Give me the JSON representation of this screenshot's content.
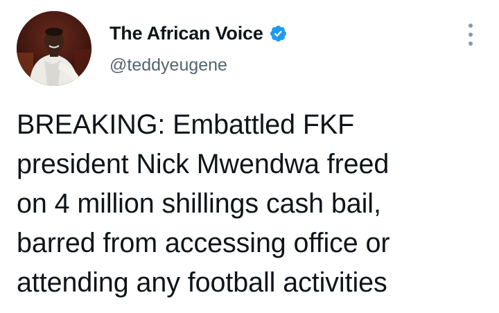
{
  "author": {
    "display_name": "The African Voice",
    "handle": "@teddyeugene",
    "verified": true,
    "verified_icon": "verified-badge-icon",
    "avatar_icon": "profile-photo"
  },
  "tweet": {
    "text": "BREAKING: Embattled FKF\npresident Nick Mwendwa freed\non 4 million shillings cash bail,\nbarred from accessing office or\nattending any football activities"
  },
  "menu": {
    "icon": "more-options-icon"
  },
  "colors": {
    "text": "#0f1419",
    "secondary": "#536471",
    "verified": "#1d9bf0",
    "background": "#ffffff"
  }
}
